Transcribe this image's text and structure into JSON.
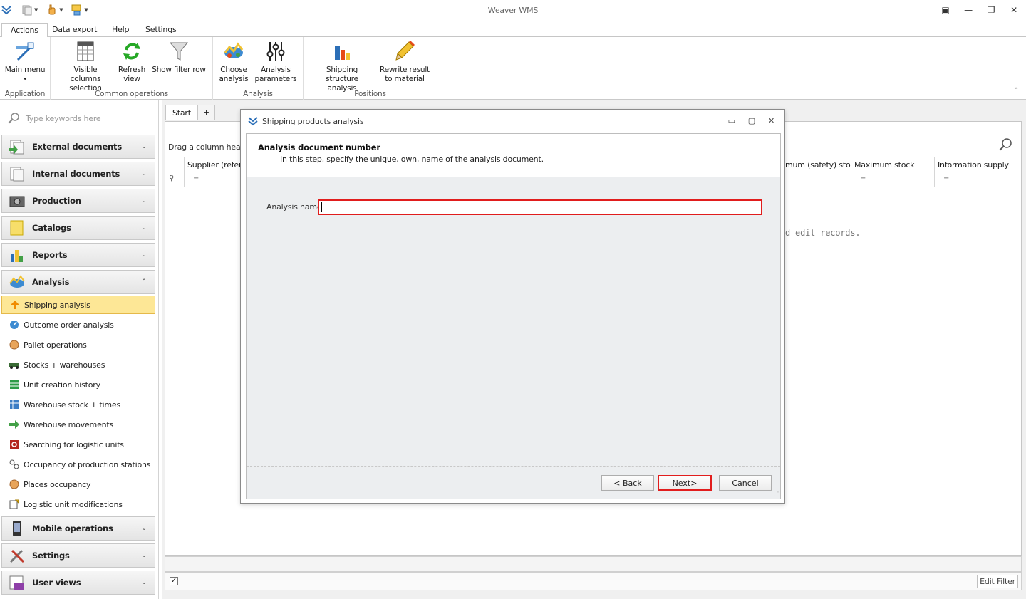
{
  "app": {
    "title": "Weaver WMS"
  },
  "ribbon_tabs": [
    "Actions",
    "Data export",
    "Help",
    "Settings"
  ],
  "ribbon": {
    "groups": [
      {
        "label": "Application",
        "buttons": [
          {
            "label1": "Main menu",
            "label2": "▾"
          }
        ]
      },
      {
        "label": "Common operations",
        "buttons": [
          {
            "label1": "Visible columns",
            "label2": "selection"
          },
          {
            "label1": "Refresh",
            "label2": "view"
          },
          {
            "label1": "Show filter row",
            "label2": ""
          }
        ]
      },
      {
        "label": "Analysis",
        "buttons": [
          {
            "label1": "Choose",
            "label2": "analysis"
          },
          {
            "label1": "Analysis",
            "label2": "parameters"
          }
        ]
      },
      {
        "label": "Positions",
        "buttons": [
          {
            "label1": "Shipping structure",
            "label2": "analysis"
          },
          {
            "label1": "Rewrite result",
            "label2": "to material"
          }
        ]
      }
    ]
  },
  "sidebar": {
    "search_placeholder": "Type keywords here",
    "groups_top": [
      {
        "label": "External documents"
      },
      {
        "label": "Internal documents"
      },
      {
        "label": "Production"
      },
      {
        "label": "Catalogs"
      },
      {
        "label": "Reports"
      },
      {
        "label": "Analysis"
      }
    ],
    "items": [
      {
        "label": "Shipping analysis"
      },
      {
        "label": "Outcome order analysis"
      },
      {
        "label": "Pallet operations"
      },
      {
        "label": "Stocks + warehouses"
      },
      {
        "label": "Unit creation history"
      },
      {
        "label": "Warehouse stock + times"
      },
      {
        "label": "Warehouse movements"
      },
      {
        "label": "Searching for logistic units"
      },
      {
        "label": "Occupancy of production stations"
      },
      {
        "label": "Places occupancy"
      },
      {
        "label": "Logistic unit modifications"
      }
    ],
    "groups_bottom": [
      {
        "label": "Mobile operations"
      },
      {
        "label": "Settings"
      },
      {
        "label": "User views"
      }
    ]
  },
  "main": {
    "tabs": [
      "Start",
      "+"
    ],
    "group_panel_text": "Drag a column heade",
    "columns": [
      "Supplier (refere",
      "mum (safety) sto...",
      "Maximum stock",
      "Information supply"
    ],
    "filter_symbol": "=",
    "empty_text": "d edit records.",
    "edit_filter_label": "Edit Filter"
  },
  "dialog": {
    "title": "Shipping products analysis",
    "header_title": "Analysis document number",
    "header_subtitle": "In this step, specify the unique, own, name of the analysis document.",
    "field_label": "Analysis name",
    "field_value": "",
    "buttons": {
      "back": "< Back",
      "next": "Next>",
      "cancel": "Cancel"
    }
  },
  "colors": {
    "highlight_red": "#e11d1d",
    "selected_item": "#fde796",
    "brand_blue": "#2c6fb7"
  }
}
